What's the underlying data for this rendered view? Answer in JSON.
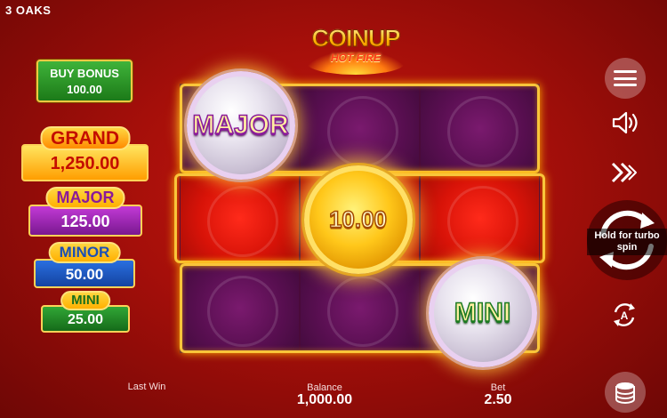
{
  "studio": "3 OAKS",
  "logo": {
    "line1": "COINUP",
    "line2": "HOT FIRE"
  },
  "buy_bonus": {
    "label": "BUY BONUS",
    "price": "100.00"
  },
  "jackpots": {
    "grand": {
      "label": "GRAND",
      "value": "1,250.00"
    },
    "major": {
      "label": "MAJOR",
      "value": "125.00"
    },
    "minor": {
      "label": "MINOR",
      "value": "50.00"
    },
    "mini": {
      "label": "MINI",
      "value": "25.00"
    }
  },
  "reels": {
    "rows": [
      [
        "purple",
        "purple",
        "purple"
      ],
      [
        "red",
        "red",
        "red"
      ],
      [
        "purple",
        "purple",
        "purple"
      ]
    ],
    "coins": [
      {
        "kind": "jackpot",
        "label": "MAJOR",
        "row": 0,
        "col": 0
      },
      {
        "kind": "value",
        "label": "10.00",
        "row": 1,
        "col": 1
      },
      {
        "kind": "jackpot",
        "label": "MINI",
        "row": 2,
        "col": 2
      }
    ]
  },
  "footer": {
    "last_win_label": "Last Win",
    "balance_label": "Balance",
    "balance_value": "1,000.00",
    "bet_label": "Bet",
    "bet_value": "2.50"
  },
  "controls": {
    "spin_hint": "Hold for turbo spin",
    "icons": [
      "menu-icon",
      "sound-icon",
      "turbo-icon",
      "spin-icon",
      "autoplay-icon",
      "bet-coins-icon"
    ]
  },
  "colors": {
    "accent_gold": "#f9c53a",
    "background_red": "#b0100a"
  }
}
